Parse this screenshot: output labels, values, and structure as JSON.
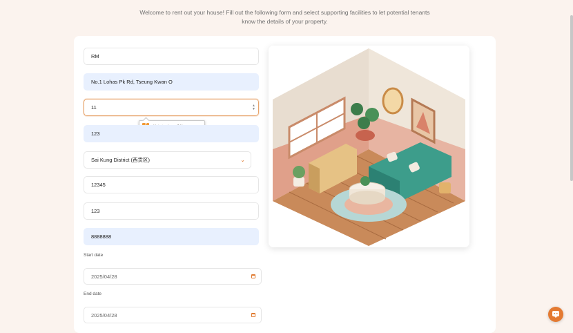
{
  "intro": "Welcome to rent out your house! Fill out the following form and select supporting facilities to let potential tenants know the details of your property.",
  "form": {
    "room": "RM",
    "address": "No.1 Lohas Pk Rd, Tseung Kwan O",
    "floor": "11",
    "unit": "123",
    "district": "Sai Kung District (西贡区)",
    "field6": "12345",
    "field7": "123",
    "phone": "8888888",
    "start_date_label": "Start date",
    "start_date": "2025/04/28",
    "end_date_label": "End date",
    "end_date": "2025/04/28"
  },
  "tooltip": {
    "icon": "!",
    "text": "值必须小于或等于 10。"
  },
  "colors": {
    "accent": "#e47a32",
    "autofill": "#e8f0fe",
    "page_bg": "#fbf3ee"
  }
}
